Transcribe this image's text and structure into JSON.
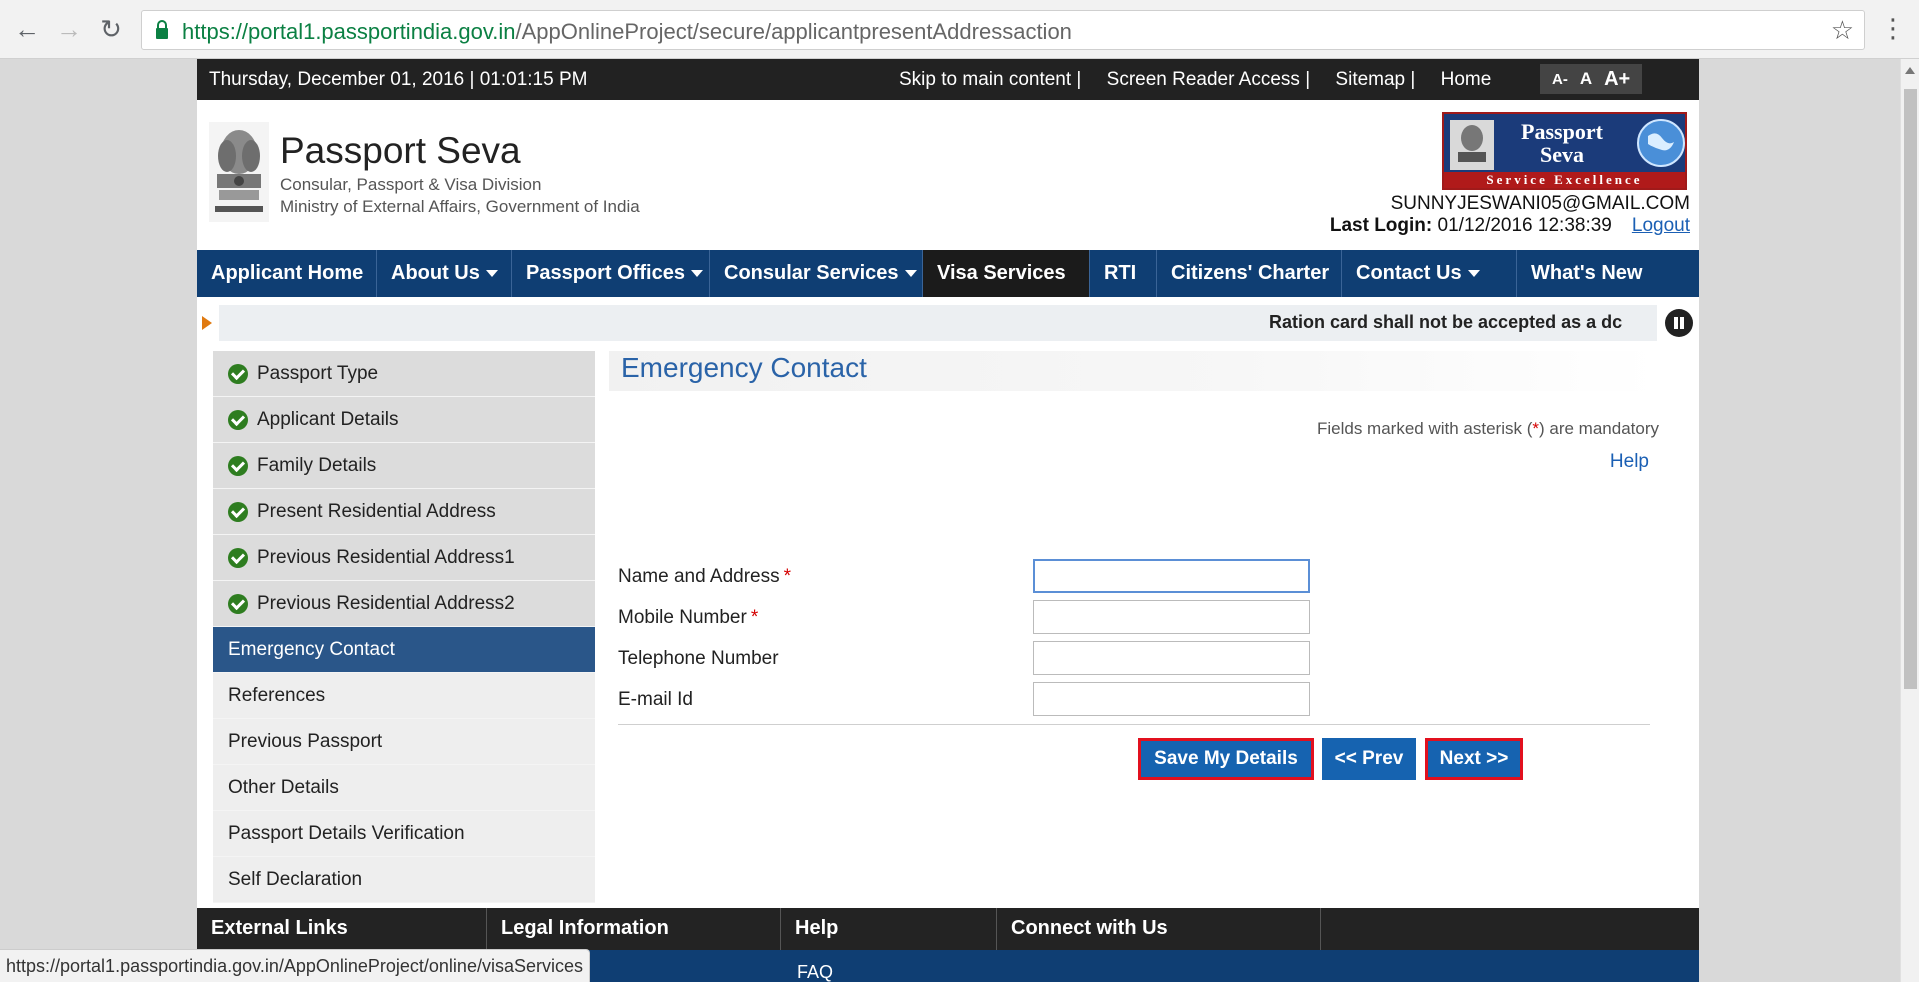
{
  "browser": {
    "url_scheme": "https://",
    "url_host": "portal1.passportindia.gov.in",
    "url_path": "/AppOnlineProject/secure/applicantpresentAddressaction",
    "status_url": "https://portal1.passportindia.gov.in/AppOnlineProject/online/visaServices"
  },
  "top_strip": {
    "datetime": "Thursday,  December  01, 2016 | 01:01:15 PM",
    "links": [
      "Skip to main content  |",
      "Screen Reader Access  |",
      "Sitemap  |",
      "Home"
    ],
    "font_controls": [
      "A-",
      "A",
      "A+"
    ]
  },
  "header": {
    "title": "Passport Seva",
    "subtitle1": "Consular, Passport & Visa Division",
    "subtitle2": "Ministry of External Affairs, Government of India",
    "logo_title": "Passport Seva",
    "logo_tagline": "Service Excellence",
    "user_email": "SUNNYJESWANI05@GMAIL.COM",
    "last_login_label": "Last Login:",
    "last_login_value": "01/12/2016 12:38:39",
    "logout": "Logout"
  },
  "main_nav": [
    {
      "label": "Applicant Home",
      "dropdown": false
    },
    {
      "label": "About Us",
      "dropdown": true
    },
    {
      "label": "Passport Offices",
      "dropdown": true
    },
    {
      "label": "Consular Services",
      "dropdown": true
    },
    {
      "label": "Visa Services",
      "dropdown": false,
      "active": true
    },
    {
      "label": "RTI",
      "dropdown": false
    },
    {
      "label": "Citizens' Charter",
      "dropdown": false
    },
    {
      "label": "Contact Us",
      "dropdown": true
    },
    {
      "label": "What's New",
      "dropdown": false
    }
  ],
  "ticker": {
    "text": "Ration card shall not be accepted as a dc"
  },
  "sidebar": {
    "items": [
      {
        "label": "Passport Type",
        "state": "done"
      },
      {
        "label": "Applicant Details",
        "state": "done"
      },
      {
        "label": "Family Details",
        "state": "done"
      },
      {
        "label": "Present Residential Address",
        "state": "done"
      },
      {
        "label": "Previous Residential Address1",
        "state": "done"
      },
      {
        "label": "Previous Residential Address2",
        "state": "done"
      },
      {
        "label": "Emergency Contact",
        "state": "current"
      },
      {
        "label": "References",
        "state": "todo"
      },
      {
        "label": "Previous Passport",
        "state": "todo"
      },
      {
        "label": "Other Details",
        "state": "todo"
      },
      {
        "label": "Passport Details Verification",
        "state": "todo"
      },
      {
        "label": "Self Declaration",
        "state": "todo"
      }
    ]
  },
  "content": {
    "title": "Emergency Contact",
    "mandatory_prefix": "Fields marked with asterisk (",
    "mandatory_asterisk": "*",
    "mandatory_suffix": ") are mandatory",
    "help": "Help",
    "fields": [
      {
        "label": "Name and Address",
        "required": true,
        "value": ""
      },
      {
        "label": "Mobile Number",
        "required": true,
        "value": ""
      },
      {
        "label": "Telephone Number",
        "required": false,
        "value": ""
      },
      {
        "label": "E-mail Id",
        "required": false,
        "value": ""
      }
    ],
    "buttons": {
      "save": "Save My Details",
      "prev": "<< Prev",
      "next": "Next >>"
    }
  },
  "footer": {
    "items": [
      "External Links",
      "Legal Information",
      "Help",
      "Connect with Us"
    ],
    "faq": "FAQ"
  },
  "colors": {
    "nav_blue": "#0f3e73",
    "active_sidebar": "#2a5689",
    "button_blue": "#1663b0",
    "highlight_red": "#e2101e",
    "done_green": "#2e7d20"
  }
}
